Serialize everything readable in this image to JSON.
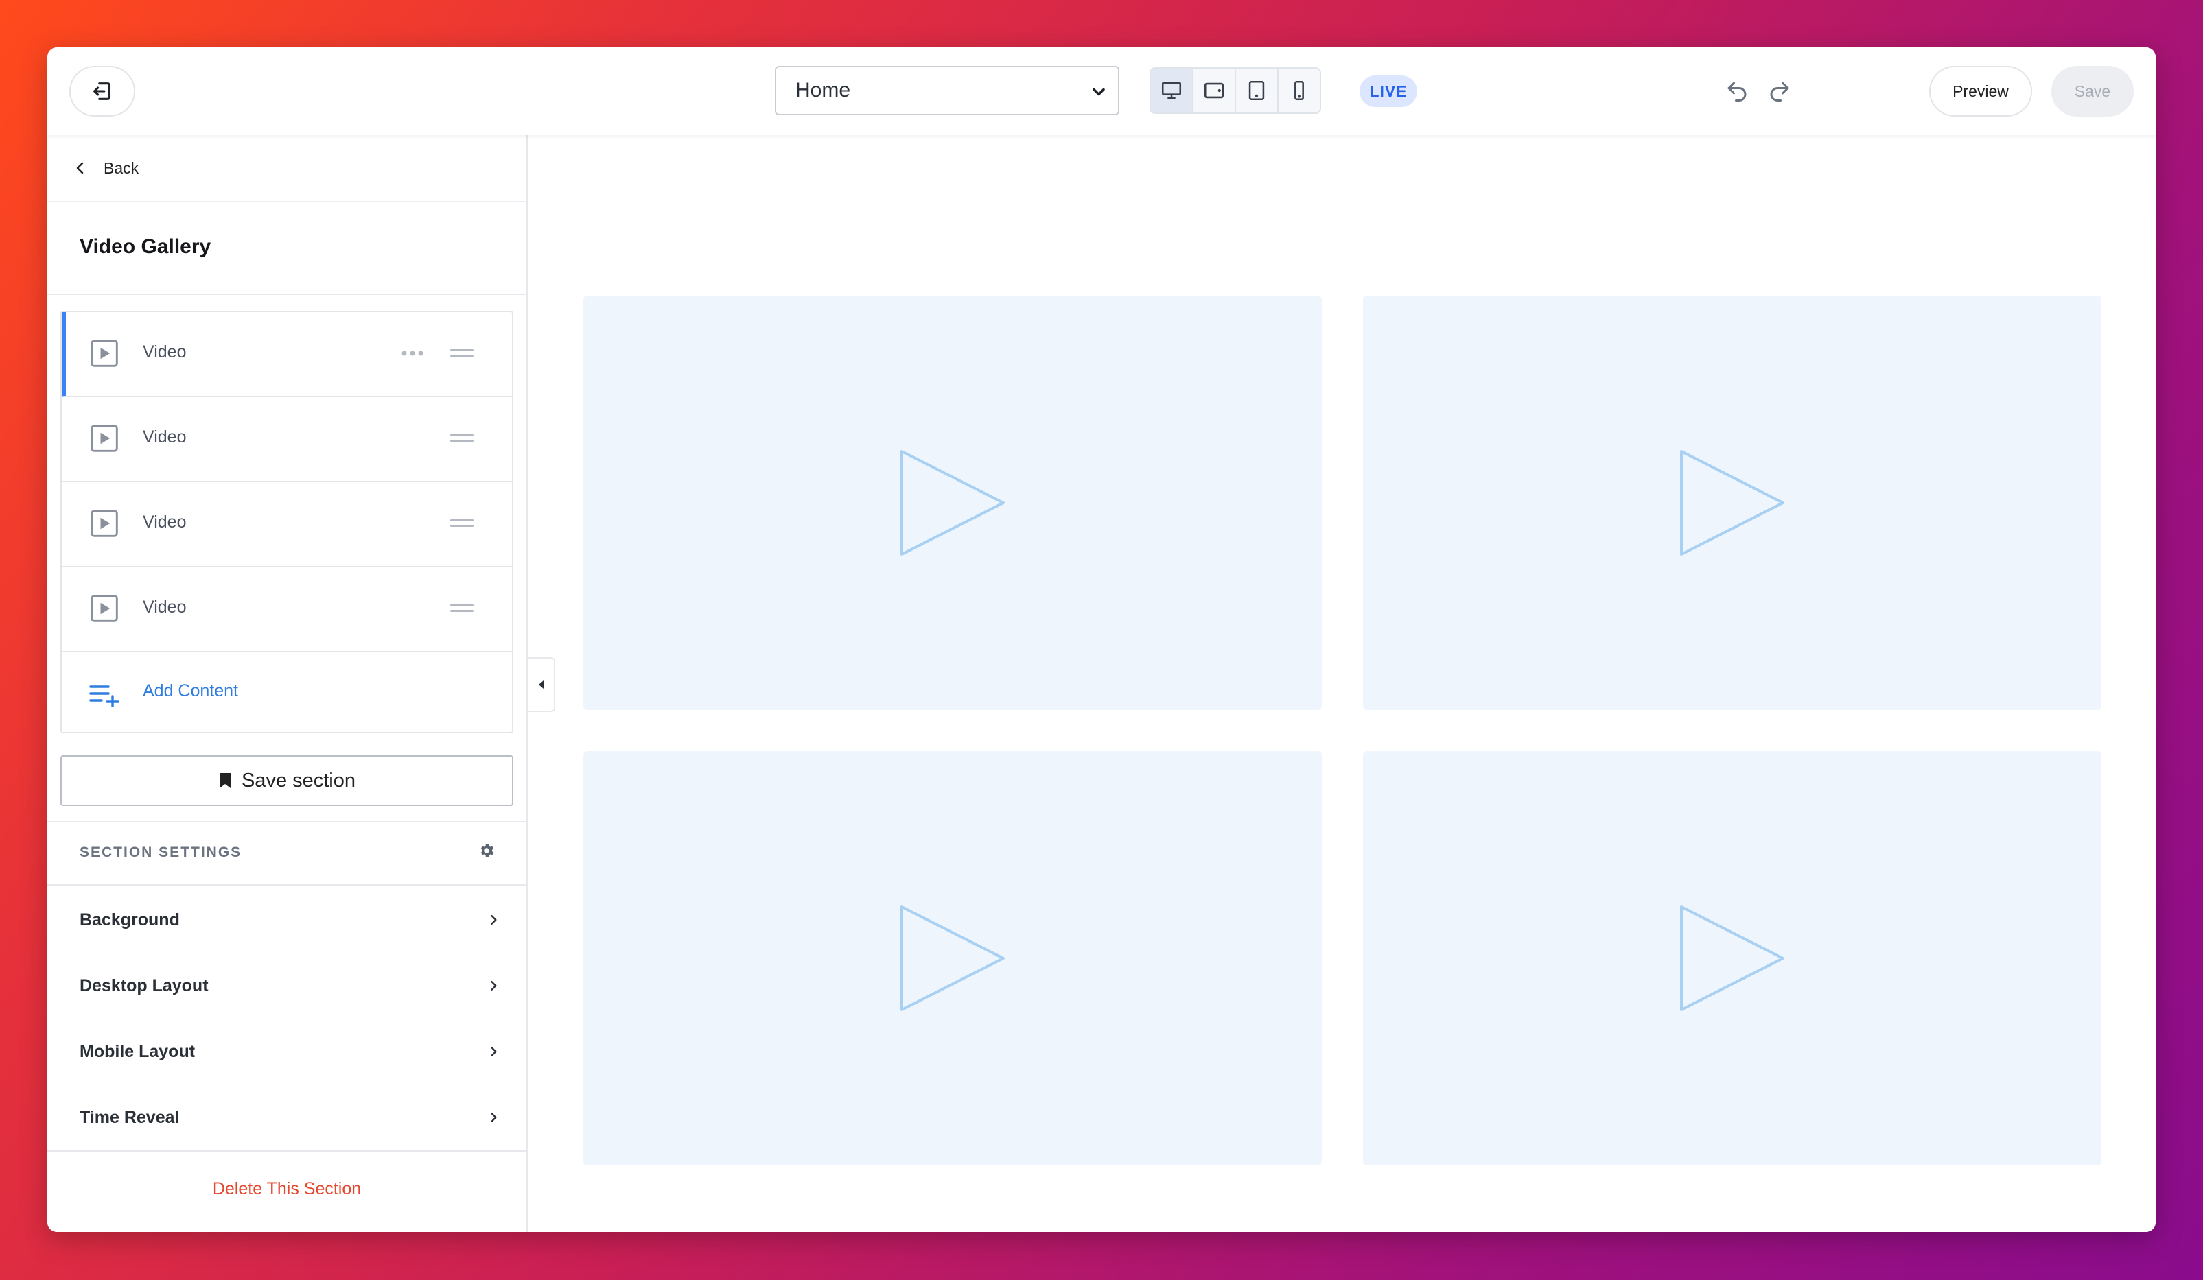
{
  "topbar": {
    "page_select": {
      "value": "Home"
    },
    "device_modes": [
      "desktop",
      "tablet-landscape",
      "tablet-portrait",
      "mobile"
    ],
    "active_device": "desktop",
    "live_label": "LIVE",
    "preview_label": "Preview",
    "save_label": "Save"
  },
  "sidebar": {
    "back_label": "Back",
    "section_title": "Video Gallery",
    "items": [
      {
        "label": "Video"
      },
      {
        "label": "Video"
      },
      {
        "label": "Video"
      },
      {
        "label": "Video"
      }
    ],
    "add_content_label": "Add Content",
    "save_section_label": "Save section",
    "settings_header": "SECTION SETTINGS",
    "settings": [
      {
        "label": "Background"
      },
      {
        "label": "Desktop Layout"
      },
      {
        "label": "Mobile Layout"
      },
      {
        "label": "Time Reveal"
      }
    ],
    "delete_label": "Delete This Section"
  },
  "colors": {
    "accent": "#3b82f6",
    "link": "#2f7de0",
    "danger": "#e5472d",
    "tile_bg": "#eef5fd",
    "play_stroke": "#a8d0f2"
  },
  "canvas": {
    "videos": [
      {
        "icon": "play-icon"
      },
      {
        "icon": "play-icon"
      },
      {
        "icon": "play-icon"
      },
      {
        "icon": "play-icon"
      }
    ]
  }
}
